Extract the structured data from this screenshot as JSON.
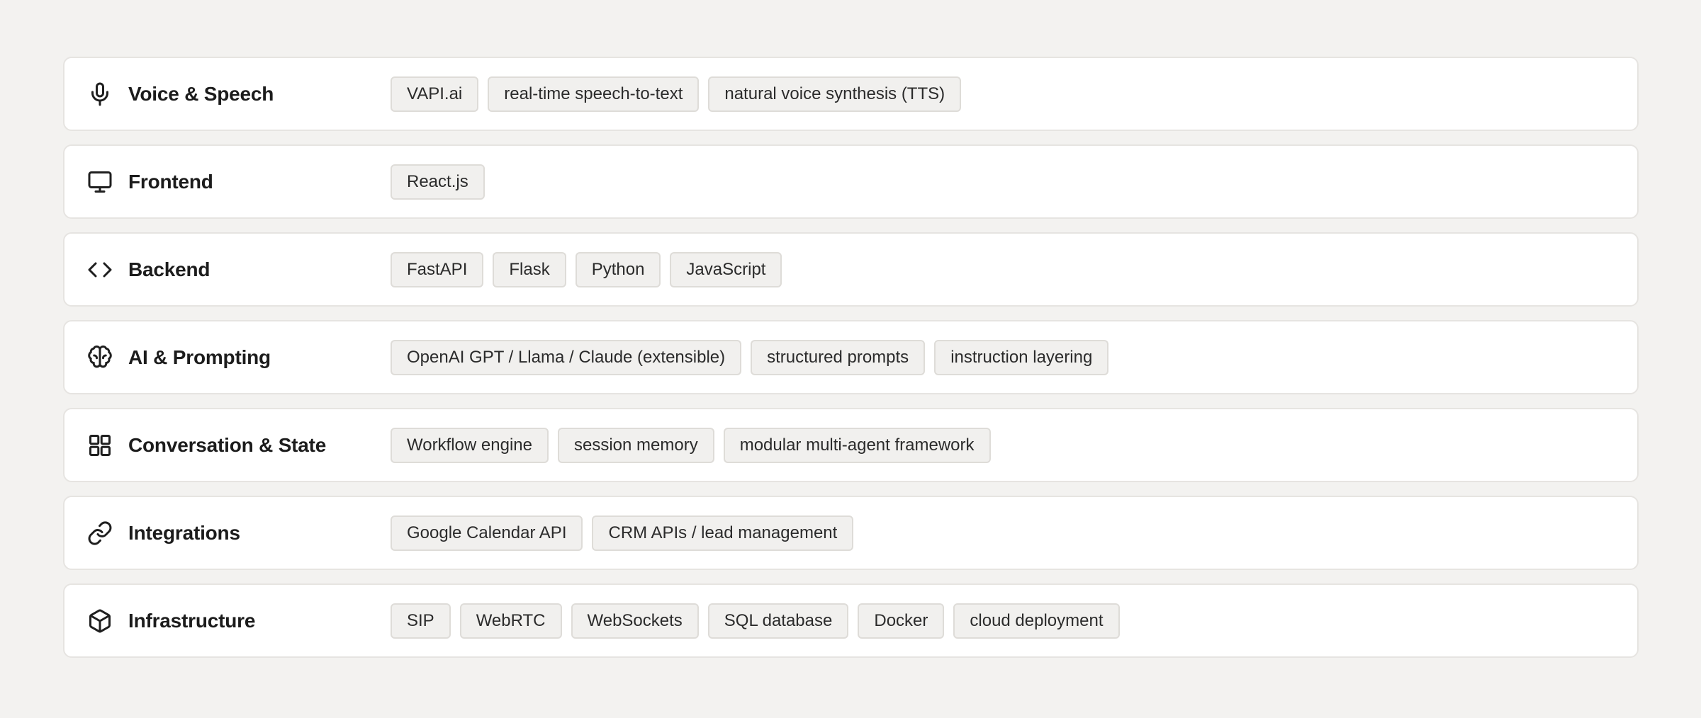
{
  "categories": [
    {
      "label": "Voice & Speech",
      "icon": "microphone-icon",
      "tags": [
        "VAPI.ai",
        "real-time speech-to-text",
        "natural voice synthesis (TTS)"
      ]
    },
    {
      "label": "Frontend",
      "icon": "monitor-icon",
      "tags": [
        "React.js"
      ]
    },
    {
      "label": "Backend",
      "icon": "code-icon",
      "tags": [
        "FastAPI",
        "Flask",
        "Python",
        "JavaScript"
      ]
    },
    {
      "label": "AI & Prompting",
      "icon": "brain-icon",
      "tags": [
        "OpenAI GPT / Llama / Claude (extensible)",
        "structured prompts",
        "instruction layering"
      ]
    },
    {
      "label": "Conversation & State",
      "icon": "grid-icon",
      "tags": [
        "Workflow engine",
        "session memory",
        "modular multi-agent framework"
      ]
    },
    {
      "label": "Integrations",
      "icon": "link-icon",
      "tags": [
        "Google Calendar API",
        "CRM APIs / lead management"
      ]
    },
    {
      "label": "Infrastructure",
      "icon": "box-icon",
      "tags": [
        "SIP",
        "WebRTC",
        "WebSockets",
        "SQL database",
        "Docker",
        "cloud deployment"
      ]
    }
  ]
}
